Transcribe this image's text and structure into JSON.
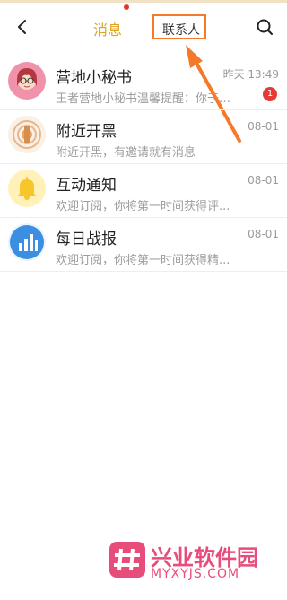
{
  "header": {
    "tabs": [
      {
        "label": "消息"
      },
      {
        "label": "联系人"
      }
    ]
  },
  "messages": [
    {
      "name": "营地小秘书",
      "time": "昨天 13:49",
      "preview": "王者营地小秘书温馨提醒：你于0...",
      "badge": "1"
    },
    {
      "name": "附近开黑",
      "time": "08-01",
      "preview": "附近开黑，有邀请就有消息"
    },
    {
      "name": "互动通知",
      "time": "08-01",
      "preview": "欢迎订阅，你将第一时间获得评..."
    },
    {
      "name": "每日战报",
      "time": "08-01",
      "preview": "欢迎订阅，你将第一时间获得精..."
    }
  ],
  "watermark": {
    "title": "兴业软件园",
    "url": "MYXYJS.COM"
  },
  "colors": {
    "active_tab": "#e0a21a",
    "highlight_box": "#f47a2a",
    "badge": "#e53935",
    "watermark": "#e84c7b"
  },
  "icons": [
    "back-arrow-icon",
    "search-icon",
    "avatar-secretary",
    "target-icon",
    "bell-icon",
    "bar-chart-icon",
    "watermark-logo-icon"
  ]
}
